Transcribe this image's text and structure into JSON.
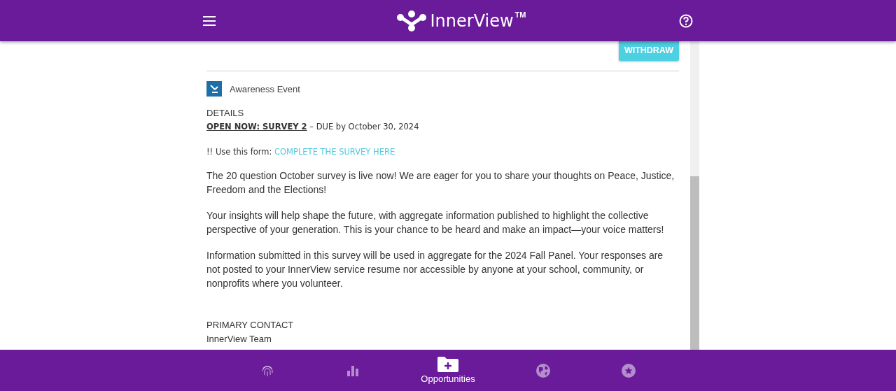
{
  "header": {
    "brand": "InnerView",
    "trademark": "TM"
  },
  "withdraw_button": "WITHDRAW",
  "category": "Awareness Event",
  "details": {
    "heading": "DETAILS",
    "survey_title": "OPEN NOW: SURVEY 2",
    "due": " – DUE by October 30, 2024",
    "form_prompt": "!! Use this form:",
    "form_link": "COMPLETE THE SURVEY HERE"
  },
  "paragraphs": [
    "The 20 question October survey is live now! We are eager for you to share your thoughts on Peace, Justice, Freedom and the Elections!",
    "Your insights will help shape the future, with aggregate information published to highlight the collective perspective of your generation. This is your chance to be heard and make an impact—your voice matters!",
    "Information submitted in this survey will be used in aggregate for the 2024 Fall Panel. Your responses are not posted to your InnerView service resume nor accessible by anyone at your school, community, or nonprofits where you volunteer."
  ],
  "primary_contact": {
    "heading": "PRIMARY CONTACT",
    "name": "InnerView Team"
  },
  "nav_items": [
    {
      "kind": "fingerprint",
      "selected": false
    },
    {
      "kind": "chart",
      "selected": false
    },
    {
      "kind": "folder",
      "label": "Opportunities",
      "selected": true
    },
    {
      "kind": "globe",
      "selected": false
    },
    {
      "kind": "star",
      "selected": false
    }
  ]
}
